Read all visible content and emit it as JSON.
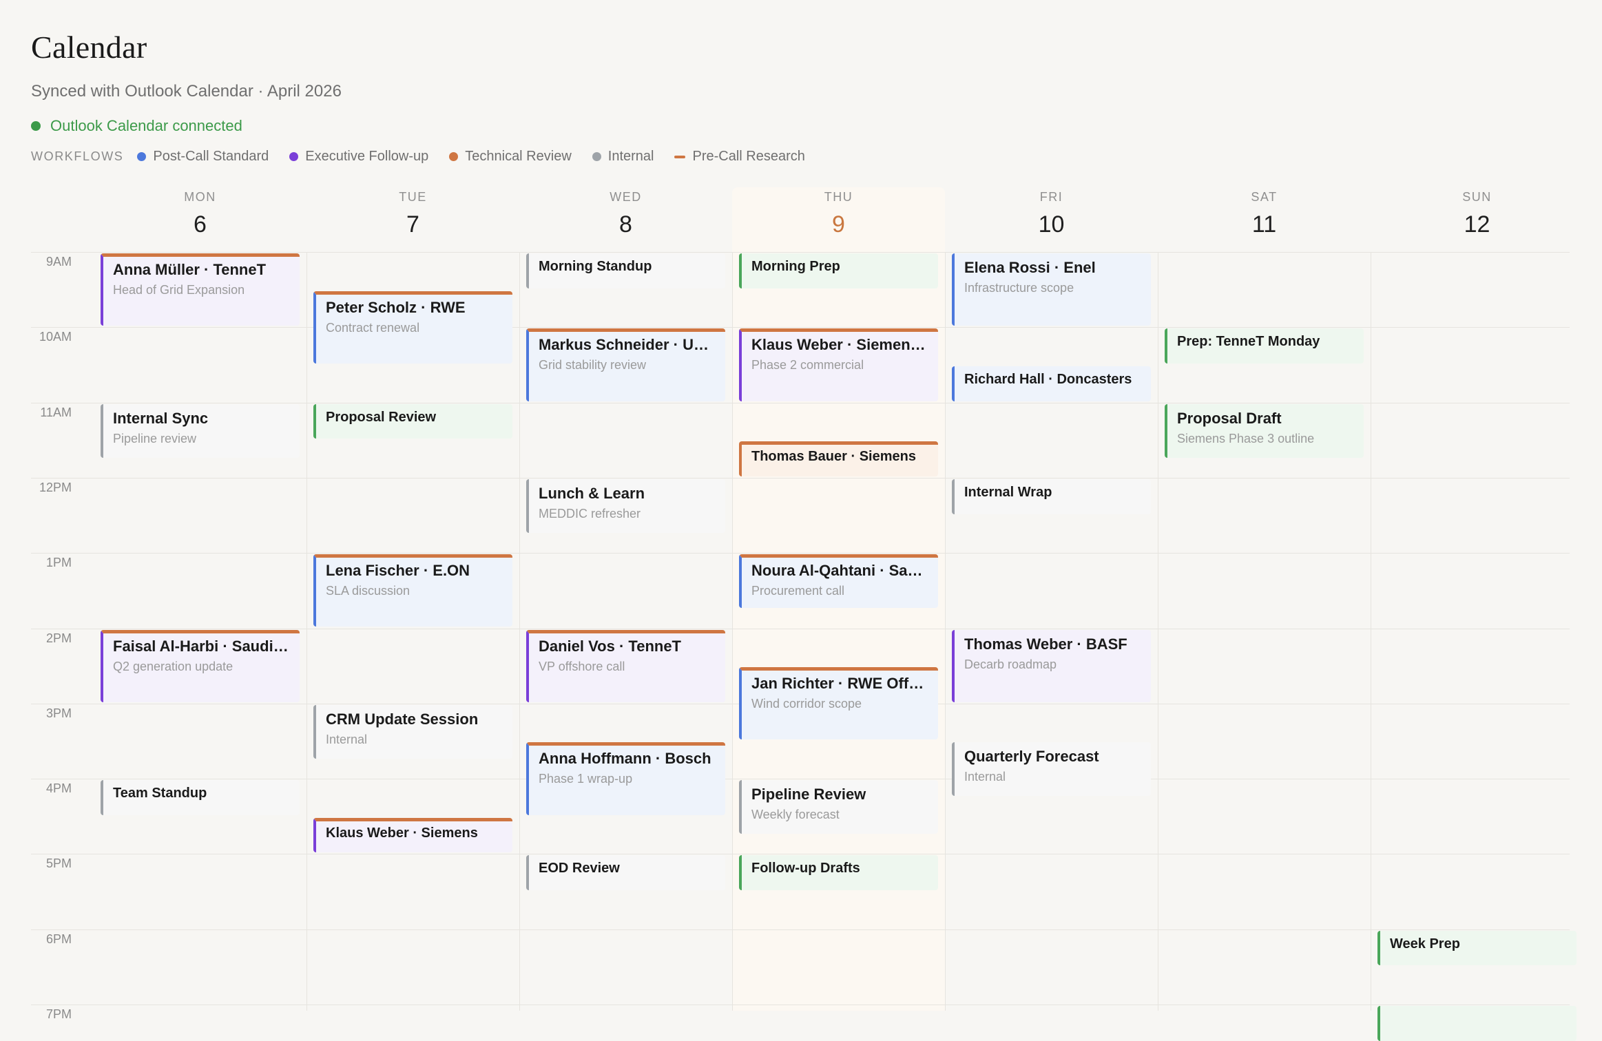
{
  "header": {
    "title": "Calendar",
    "subtitle": "Synced with Outlook Calendar · April 2026",
    "connection_status": "Outlook Calendar connected"
  },
  "colors": {
    "post_call_standard": "#4c78dc",
    "executive_follow_up": "#7a3fd8",
    "technical_review": "#cf7642",
    "internal": "#9ea3a8",
    "pre_call_research": "#cf7642",
    "connected": "#3c9a49",
    "today": "#c9773f"
  },
  "legend": {
    "title": "WORKFLOWS",
    "items": [
      {
        "label": "Post-Call Standard",
        "color": "#4c78dc",
        "marker": "dot"
      },
      {
        "label": "Executive Follow-up",
        "color": "#7a3fd8",
        "marker": "dot"
      },
      {
        "label": "Technical Review",
        "color": "#cf7642",
        "marker": "dot"
      },
      {
        "label": "Internal",
        "color": "#9ea3a8",
        "marker": "dot"
      },
      {
        "label": "Pre-Call Research",
        "color": "#cf7642",
        "marker": "dash"
      }
    ]
  },
  "days": [
    {
      "dow": "MON",
      "num": "6"
    },
    {
      "dow": "TUE",
      "num": "7"
    },
    {
      "dow": "WED",
      "num": "8"
    },
    {
      "dow": "THU",
      "num": "9",
      "today": true
    },
    {
      "dow": "FRI",
      "num": "10"
    },
    {
      "dow": "SAT",
      "num": "11"
    },
    {
      "dow": "SUN",
      "num": "12"
    }
  ],
  "hours": [
    "9AM",
    "10AM",
    "11AM",
    "12PM",
    "1PM",
    "2PM",
    "3PM",
    "4PM",
    "5PM",
    "6PM",
    "7PM"
  ],
  "events": [
    {
      "day": 0,
      "start": 9.0,
      "end": 10.0,
      "title": "Anna Müller · TenneT",
      "subtitle": "Head of Grid Expansion",
      "style": "purple",
      "precall": true
    },
    {
      "day": 0,
      "start": 11.0,
      "end": 11.75,
      "title": "Internal Sync",
      "subtitle": "Pipeline review",
      "style": "gray"
    },
    {
      "day": 0,
      "start": 14.0,
      "end": 15.0,
      "title": "Faisal Al-Harbi · Saudi Aramco",
      "subtitle": "Q2 generation update",
      "style": "purple",
      "precall": true
    },
    {
      "day": 0,
      "start": 16.0,
      "end": 16.5,
      "title": "Team Standup",
      "style": "gray"
    },
    {
      "day": 1,
      "start": 9.5,
      "end": 10.5,
      "title": "Peter Scholz · RWE",
      "subtitle": "Contract renewal",
      "style": "blue",
      "precall": true
    },
    {
      "day": 1,
      "start": 11.0,
      "end": 11.5,
      "title": "Proposal Review",
      "style": "green"
    },
    {
      "day": 1,
      "start": 13.0,
      "end": 14.0,
      "title": "Lena Fischer · E.ON",
      "subtitle": "SLA discussion",
      "style": "blue",
      "precall": true
    },
    {
      "day": 1,
      "start": 15.0,
      "end": 15.75,
      "title": "CRM Update Session",
      "subtitle": "Internal",
      "style": "gray"
    },
    {
      "day": 1,
      "start": 16.5,
      "end": 17.0,
      "title": "Klaus Weber · Siemens",
      "style": "purple",
      "precall": true
    },
    {
      "day": 2,
      "start": 9.0,
      "end": 9.5,
      "title": "Morning Standup",
      "style": "gray"
    },
    {
      "day": 2,
      "start": 10.0,
      "end": 11.0,
      "title": "Markus Schneider · Uniper",
      "subtitle": "Grid stability review",
      "style": "blue",
      "precall": true
    },
    {
      "day": 2,
      "start": 12.0,
      "end": 12.75,
      "title": "Lunch & Learn",
      "subtitle": "MEDDIC refresher",
      "style": "gray"
    },
    {
      "day": 2,
      "start": 14.0,
      "end": 15.0,
      "title": "Daniel Vos · TenneT",
      "subtitle": "VP offshore call",
      "style": "purple",
      "precall": true
    },
    {
      "day": 2,
      "start": 15.5,
      "end": 16.5,
      "title": "Anna Hoffmann · Bosch",
      "subtitle": "Phase 1 wrap-up",
      "style": "blue",
      "precall": true
    },
    {
      "day": 2,
      "start": 17.0,
      "end": 17.5,
      "title": "EOD Review",
      "style": "gray"
    },
    {
      "day": 3,
      "start": 9.0,
      "end": 9.5,
      "title": "Morning Prep",
      "style": "green"
    },
    {
      "day": 3,
      "start": 10.0,
      "end": 11.0,
      "title": "Klaus Weber · Siemens Energy",
      "subtitle": "Phase 2 commercial",
      "style": "purple",
      "precall": true
    },
    {
      "day": 3,
      "start": 11.5,
      "end": 12.0,
      "title": "Thomas Bauer · Siemens",
      "style": "orange",
      "precall": true
    },
    {
      "day": 3,
      "start": 13.0,
      "end": 13.75,
      "title": "Noura Al-Qahtani · Saudi Electricity",
      "subtitle": "Procurement call",
      "style": "blue",
      "precall": true
    },
    {
      "day": 3,
      "start": 14.5,
      "end": 15.5,
      "title": "Jan Richter · RWE Offshore",
      "subtitle": "Wind corridor scope",
      "style": "blue",
      "precall": true
    },
    {
      "day": 3,
      "start": 16.0,
      "end": 16.75,
      "title": "Pipeline Review",
      "subtitle": "Weekly forecast",
      "style": "gray"
    },
    {
      "day": 3,
      "start": 17.0,
      "end": 17.5,
      "title": "Follow-up Drafts",
      "style": "green"
    },
    {
      "day": 4,
      "start": 9.0,
      "end": 10.0,
      "title": "Elena Rossi · Enel",
      "subtitle": "Infrastructure scope",
      "style": "blue"
    },
    {
      "day": 4,
      "start": 10.5,
      "end": 11.0,
      "title": "Richard Hall · Doncasters",
      "style": "blue"
    },
    {
      "day": 4,
      "start": 12.0,
      "end": 12.5,
      "title": "Internal Wrap",
      "style": "gray"
    },
    {
      "day": 4,
      "start": 14.0,
      "end": 15.0,
      "title": "Thomas Weber · BASF",
      "subtitle": "Decarb roadmap",
      "style": "purple"
    },
    {
      "day": 4,
      "start": 15.5,
      "end": 16.25,
      "title": "Quarterly Forecast",
      "subtitle": "Internal",
      "style": "gray"
    },
    {
      "day": 5,
      "start": 10.0,
      "end": 10.5,
      "title": "Prep: TenneT Monday",
      "style": "green"
    },
    {
      "day": 5,
      "start": 11.0,
      "end": 11.75,
      "title": "Proposal Draft",
      "subtitle": "Siemens Phase 3 outline",
      "style": "green"
    },
    {
      "day": 6,
      "start": 18.0,
      "end": 18.5,
      "title": "Week Prep",
      "style": "green"
    },
    {
      "day": 6,
      "start": 19.0,
      "end": 19.5,
      "title": "",
      "style": "green"
    }
  ]
}
